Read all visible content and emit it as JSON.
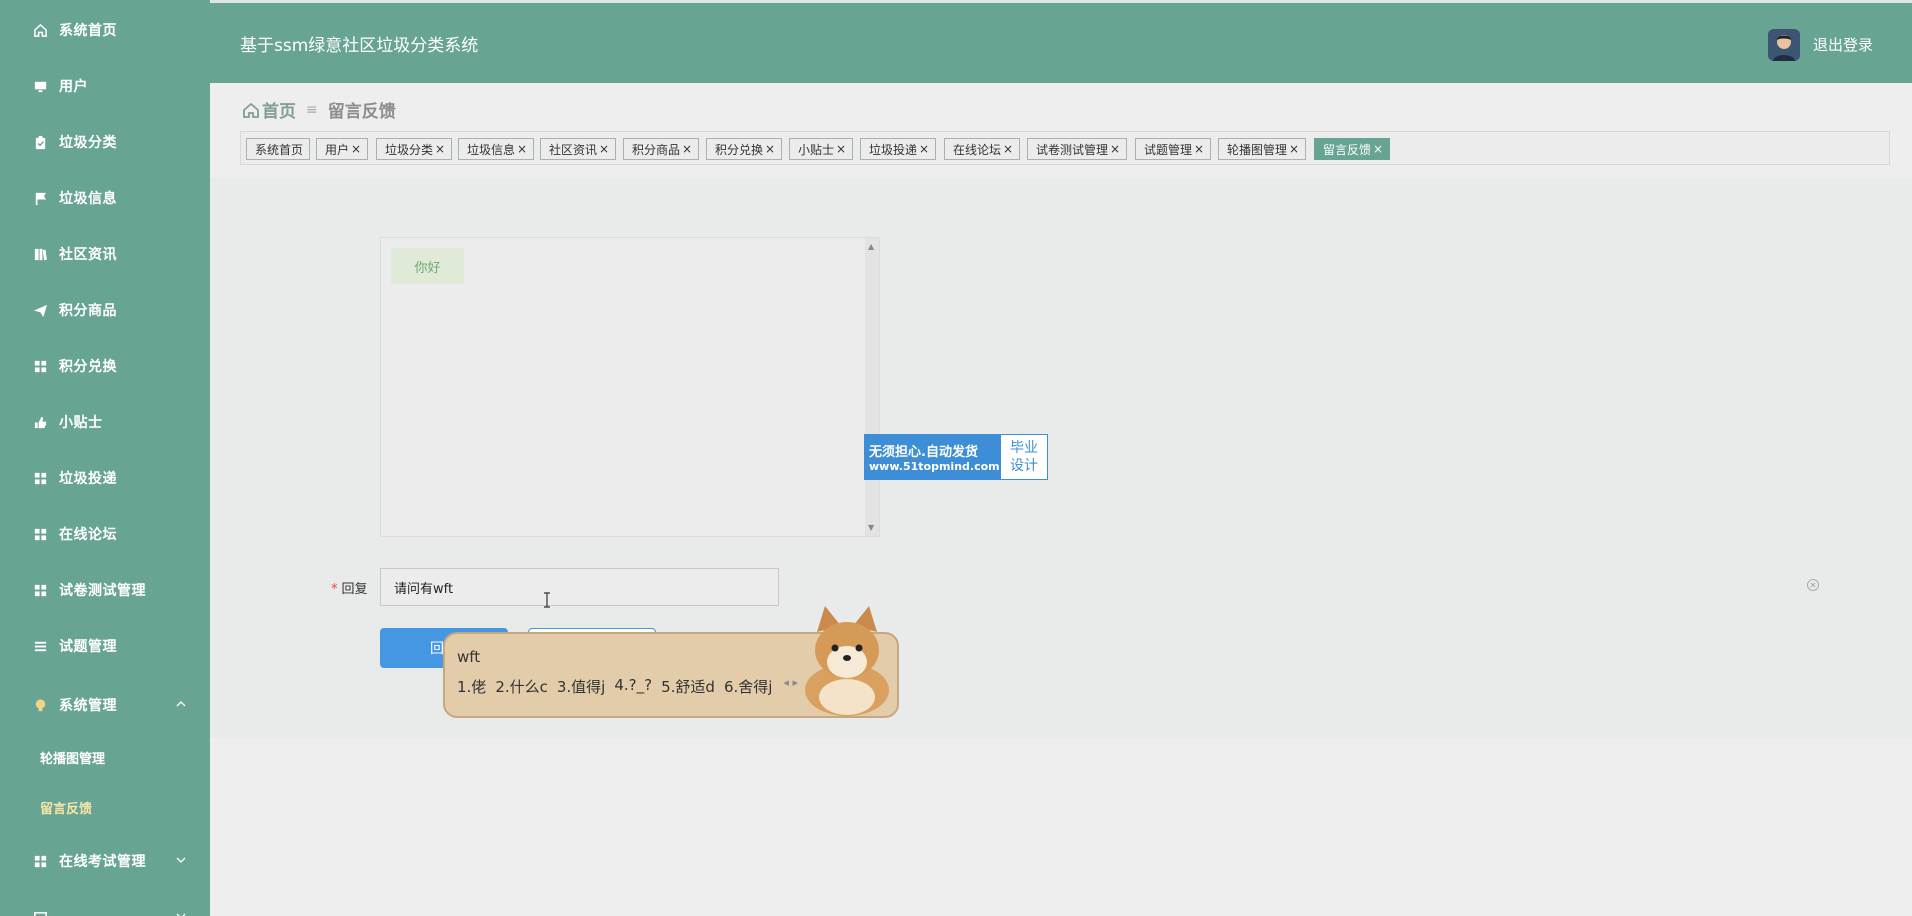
{
  "sidebar": {
    "items": [
      {
        "label": "系统首页",
        "icon": "home-icon"
      },
      {
        "label": "用户",
        "icon": "monitor-icon"
      },
      {
        "label": "垃圾分类",
        "icon": "clipboard-icon"
      },
      {
        "label": "垃圾信息",
        "icon": "flag-icon"
      },
      {
        "label": "社区资讯",
        "icon": "book-icon"
      },
      {
        "label": "积分商品",
        "icon": "send-icon"
      },
      {
        "label": "积分兑换",
        "icon": "grid-icon"
      },
      {
        "label": "小贴士",
        "icon": "thumb-icon"
      },
      {
        "label": "垃圾投递",
        "icon": "grid-icon"
      },
      {
        "label": "在线论坛",
        "icon": "grid-icon"
      },
      {
        "label": "试卷测试管理",
        "icon": "grid-icon"
      },
      {
        "label": "试题管理",
        "icon": "list-icon"
      },
      {
        "label": "系统管理",
        "icon": "bulb-icon"
      },
      {
        "label": "在线考试管理",
        "icon": "grid-icon"
      }
    ],
    "submenu": [
      {
        "label": "轮播图管理"
      },
      {
        "label": "留言反馈"
      }
    ]
  },
  "header": {
    "title": "基于ssm绿意社区垃圾分类系统",
    "logout": "退出登录"
  },
  "breadcrumb": {
    "home": "首页",
    "current": "留言反馈"
  },
  "tags": [
    {
      "label": "系统首页"
    },
    {
      "label": "用户"
    },
    {
      "label": "垃圾分类"
    },
    {
      "label": "垃圾信息"
    },
    {
      "label": "社区资讯"
    },
    {
      "label": "积分商品"
    },
    {
      "label": "积分兑换"
    },
    {
      "label": "小贴士"
    },
    {
      "label": "垃圾投递"
    },
    {
      "label": "在线论坛"
    },
    {
      "label": "试卷测试管理"
    },
    {
      "label": "试题管理"
    },
    {
      "label": "轮播图管理"
    },
    {
      "label": "留言反馈"
    }
  ],
  "chat": {
    "message": "你好"
  },
  "watermark": {
    "line1": "无须担心.自动发货",
    "line2": "www.51topmind.com",
    "right1": "毕业",
    "right2": "设计"
  },
  "form": {
    "reply_label": "回复",
    "reply_value": "请问有wft",
    "submit_label": "回复"
  },
  "ime": {
    "composition": "wft",
    "candidates": [
      "1.佬",
      "2.什么c",
      "3.值得j",
      "4.?_?",
      "5.舒适d",
      "6.舍得j"
    ]
  },
  "colors": {
    "theme": "#68a494",
    "primary_button": "#4596e3",
    "watermark": "#3d8ed6"
  }
}
